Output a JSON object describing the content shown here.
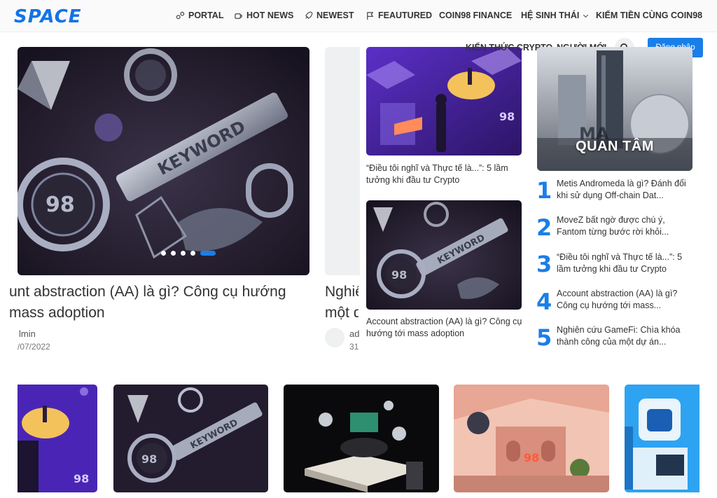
{
  "header": {
    "logo": "SPACE",
    "nav": [
      {
        "label": "PORTAL",
        "icon": "portal-icon"
      },
      {
        "label": "HOT NEWS",
        "icon": "coffee-icon"
      },
      {
        "label": "NEWEST",
        "icon": "rocket-icon"
      },
      {
        "label": "FEAUTURED",
        "icon": "flag-icon"
      },
      {
        "label": "COIN98 FINANCE"
      },
      {
        "label": "HỆ SINH THÁI",
        "icon": "chevron-down-icon"
      },
      {
        "label": "KIẾM TIỀN CÙNG COIN98"
      },
      {
        "label": "KIẾN THỨC CRYPTO"
      },
      {
        "label": "NGƯỜI MỚI"
      }
    ],
    "login_label": "Đăng nhập"
  },
  "slider": {
    "slides": [
      {
        "title_line1": "unt abstraction (AA) là gì? Công cụ hướng",
        "title_line2": "mass adoption",
        "author": "lmin",
        "date": "/07/2022"
      },
      {
        "title_line1": "Nghiê",
        "title_line2": "một d",
        "author": "ad",
        "date": "31"
      }
    ],
    "dot_count": 5,
    "active_dot": 4
  },
  "middle": [
    {
      "title": "“Điều tôi nghĩ và Thực tế là...”: 5 lầm tưởng khi đầu tư Crypto"
    },
    {
      "title": "Account abstraction (AA) là gì? Công cụ hướng tới mass adoption"
    }
  ],
  "quan_tam": {
    "heading": "QUAN TÂM",
    "items": [
      {
        "rank": "1",
        "title": "Metis Andromeda là gì? Đánh đổi khi sử dụng Off-chain Dat..."
      },
      {
        "rank": "2",
        "title": "MoveZ bất ngờ được chú ý, Fantom từng bước rời khỏi..."
      },
      {
        "rank": "3",
        "title": "“Điều tôi nghĩ và Thực tế là...”: 5 lầm tưởng khi đầu tư Crypto"
      },
      {
        "rank": "4",
        "title": "Account abstraction (AA) là gì? Công cụ hướng tới mass..."
      },
      {
        "rank": "5",
        "title": "Nghiên cứu GameFi: Chìa khóa thành công của một dự án..."
      }
    ]
  },
  "colors": {
    "accent": "#1a7ee8",
    "logo": "#1473e6",
    "text": "#333333"
  }
}
